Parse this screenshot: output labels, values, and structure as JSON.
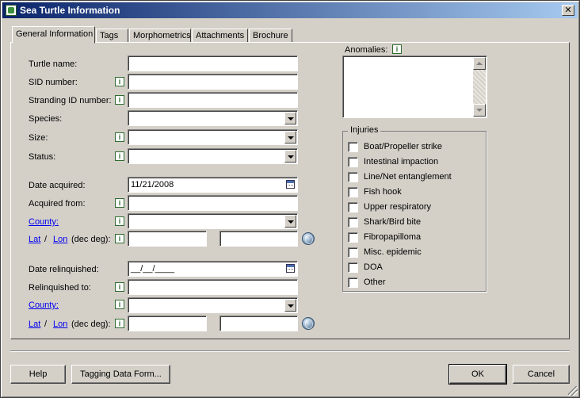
{
  "window": {
    "title": "Sea Turtle Information",
    "close_glyph": "✕"
  },
  "tabs": [
    {
      "label": "General Information"
    },
    {
      "label": "Tags"
    },
    {
      "label": "Morphometrics"
    },
    {
      "label": "Attachments"
    },
    {
      "label": "Brochure"
    }
  ],
  "info_glyph": "i",
  "form": {
    "turtle_name": {
      "label": "Turtle name:",
      "value": ""
    },
    "sid_number": {
      "label": "SID number:",
      "value": ""
    },
    "stranding_id": {
      "label": "Stranding ID number:",
      "value": ""
    },
    "species": {
      "label": "Species:",
      "value": ""
    },
    "size": {
      "label": "Size:",
      "value": ""
    },
    "status": {
      "label": "Status:",
      "value": ""
    },
    "date_acquired": {
      "label": "Date acquired:",
      "value": "11/21/2008"
    },
    "acquired_from": {
      "label": "Acquired from:",
      "value": ""
    },
    "county": {
      "label": "County:",
      "value": ""
    },
    "latlon": {
      "lat": "Lat",
      "sep": "/",
      "lon": "Lon",
      "suffix": "(dec deg):",
      "lat_value": "",
      "lon_value": ""
    },
    "date_relinquished": {
      "label": "Date relinquished:",
      "value": "__/__/____"
    },
    "relinquished_to": {
      "label": "Relinquished to:",
      "value": ""
    },
    "county2": {
      "label": "County:",
      "value": ""
    },
    "latlon2": {
      "lat": "Lat",
      "sep": "/",
      "lon": "Lon",
      "suffix": "(dec deg):",
      "lat_value": "",
      "lon_value": ""
    }
  },
  "anomalies": {
    "label": "Anomalies:",
    "value": ""
  },
  "injuries": {
    "legend": "Injuries",
    "items": [
      {
        "label": "Boat/Propeller strike",
        "checked": false
      },
      {
        "label": "Intestinal impaction",
        "checked": false
      },
      {
        "label": "Line/Net entanglement",
        "checked": false
      },
      {
        "label": "Fish hook",
        "checked": false
      },
      {
        "label": "Upper respiratory",
        "checked": false
      },
      {
        "label": "Shark/Bird bite",
        "checked": false
      },
      {
        "label": "Fibropapilloma",
        "checked": false
      },
      {
        "label": "Misc. epidemic",
        "checked": false
      },
      {
        "label": "DOA",
        "checked": false
      },
      {
        "label": "Other",
        "checked": false
      }
    ]
  },
  "buttons": {
    "help": "Help",
    "tagging": "Tagging Data Form...",
    "ok": "OK",
    "cancel": "Cancel"
  }
}
